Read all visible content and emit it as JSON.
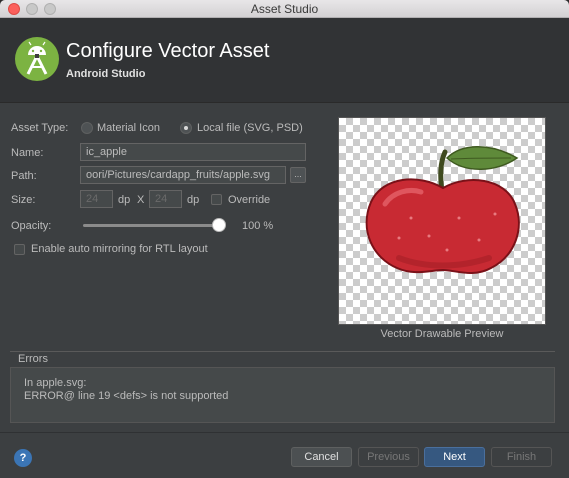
{
  "window": {
    "title": "Asset Studio"
  },
  "header": {
    "title": "Configure Vector Asset",
    "subtitle": "Android Studio"
  },
  "form": {
    "asset_type_label": "Asset Type:",
    "option_material": "Material Icon",
    "option_local": "Local file (SVG, PSD)",
    "selected_asset_type": "Local file (SVG, PSD)",
    "name_label": "Name:",
    "name_value": "ic_apple",
    "path_label": "Path:",
    "path_value": "oori/Pictures/cardapp_fruits/apple.svg",
    "browse_label": "...",
    "size_label": "Size:",
    "width_value": "24",
    "height_value": "24",
    "unit_1": "dp",
    "times": "X",
    "unit_2": "dp",
    "override_label": "Override",
    "override_checked": false,
    "opacity_label": "Opacity:",
    "opacity_value": "100 %",
    "opacity_fraction": 1.0,
    "rtl_label": "Enable auto mirroring for RTL layout",
    "rtl_checked": false
  },
  "preview": {
    "caption": "Vector Drawable Preview",
    "icon": "apple-image"
  },
  "errors": {
    "heading": "Errors",
    "line1": "In apple.svg:",
    "line2": "ERROR@ line 19 <defs> is not supported"
  },
  "buttons": {
    "help": "?",
    "cancel": "Cancel",
    "previous": "Previous",
    "next": "Next",
    "finish": "Finish"
  },
  "colors": {
    "background": "#3c3f41",
    "primary_button": "#365880",
    "apple_red": "#c82a33",
    "leaf_green": "#5f8a3a"
  }
}
